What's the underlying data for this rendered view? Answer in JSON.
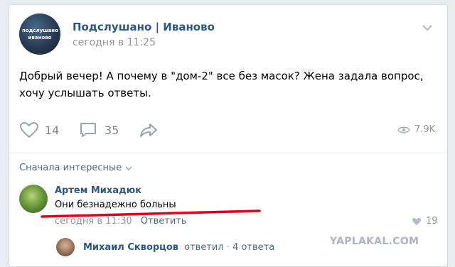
{
  "post": {
    "avatar_text_top": "подслушано",
    "avatar_text_bottom": "иваново",
    "group_name": "Подслушано | Иваново",
    "time": "сегодня в 11:25",
    "text": "Добрый вечер! А почему в \"дом-2\" все без масок? Жена задала вопрос, хочу услышать ответы.",
    "likes": "14",
    "comments": "35",
    "views": "7.9K"
  },
  "comments_section": {
    "sort_label": "Сначала интересные",
    "items": [
      {
        "author": "Артем Михадюк",
        "text": "Они безнадежно  больны",
        "time": "сегодня в 11:30",
        "reply_label": "Ответить",
        "likes": "19",
        "reply_preview": {
          "author": "Михаил Скворцов",
          "verb": "ответил",
          "separator": "·",
          "count": "4 ответа"
        }
      }
    ]
  },
  "watermark": "YAPLAKAL.COM",
  "colors": {
    "link": "#2a5885",
    "muted": "#939393",
    "underline_mark": "#e0001b"
  }
}
